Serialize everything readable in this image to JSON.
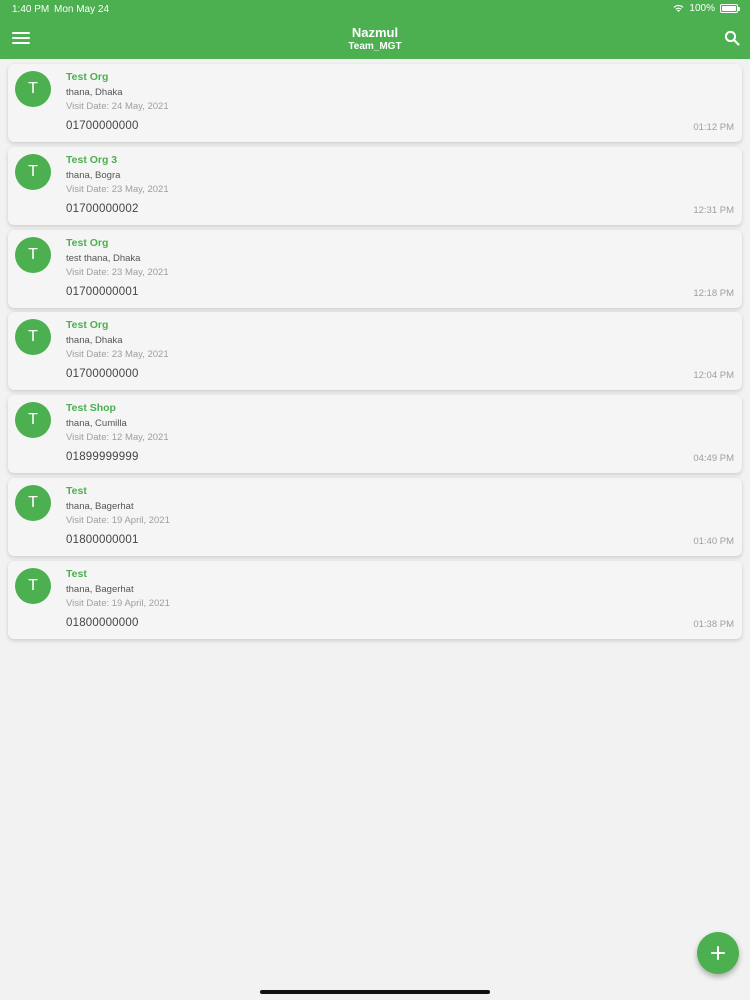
{
  "status_bar": {
    "time": "1:40 PM",
    "date": "Mon May 24",
    "battery": "100%"
  },
  "header": {
    "title": "Nazmul",
    "subtitle": "Team_MGT"
  },
  "icons": {
    "menu": "hamburger-menu-icon",
    "search": "search-icon",
    "add": "plus-icon",
    "wifi": "wifi-icon",
    "battery": "battery-icon"
  },
  "colors": {
    "accent": "#4caf50",
    "background": "#f2f2f2"
  },
  "visits": [
    {
      "initial": "T",
      "name": "Test Org",
      "address": "thana, Dhaka",
      "visit_date": "Visit Date: 24 May, 2021",
      "phone": "01700000000",
      "time": "01:12 PM"
    },
    {
      "initial": "T",
      "name": "Test Org 3",
      "address": "thana, Bogra",
      "visit_date": "Visit Date: 23 May, 2021",
      "phone": "01700000002",
      "time": "12:31 PM"
    },
    {
      "initial": "T",
      "name": "Test Org",
      "address": "test thana, Dhaka",
      "visit_date": "Visit Date: 23 May, 2021",
      "phone": "01700000001",
      "time": "12:18 PM"
    },
    {
      "initial": "T",
      "name": "Test Org",
      "address": "thana, Dhaka",
      "visit_date": "Visit Date: 23 May, 2021",
      "phone": "01700000000",
      "time": "12:04 PM"
    },
    {
      "initial": "T",
      "name": "Test Shop",
      "address": "thana, Cumilla",
      "visit_date": "Visit Date: 12 May, 2021",
      "phone": "01899999999",
      "time": "04:49 PM"
    },
    {
      "initial": "T",
      "name": "Test",
      "address": "thana, Bagerhat",
      "visit_date": "Visit Date: 19 April, 2021",
      "phone": "01800000001",
      "time": "01:40 PM"
    },
    {
      "initial": "T",
      "name": "Test",
      "address": "thana, Bagerhat",
      "visit_date": "Visit Date: 19 April, 2021",
      "phone": "01800000000",
      "time": "01:38 PM"
    }
  ]
}
